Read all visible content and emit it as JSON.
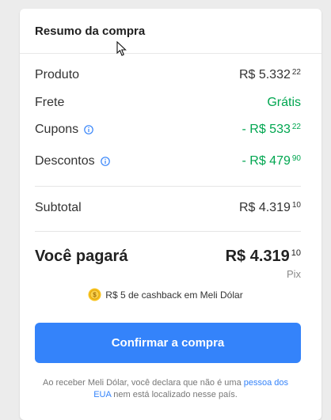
{
  "summary": {
    "title": "Resumo da compra",
    "rows": [
      {
        "label": "Produto",
        "value_main": "R$ 5.332",
        "value_cents": "22"
      },
      {
        "label": "Frete",
        "value_main": "Grátis",
        "value_cents": ""
      },
      {
        "label": "Cupons",
        "value_main": "- R$ 533",
        "value_cents": "22"
      },
      {
        "label": "Descontos",
        "value_main": "- R$ 479",
        "value_cents": "90"
      }
    ],
    "subtotal": {
      "label": "Subtotal",
      "value_main": "R$ 4.319",
      "value_cents": "10"
    },
    "total": {
      "label": "Você pagará",
      "value_main": "R$ 4.319",
      "value_cents": "10",
      "method": "Pix"
    },
    "cashback": "R$ 5 de cashback em Meli Dólar",
    "confirm_button": "Confirmar a compra",
    "disclaimer_text": "Ao receber Meli Dólar, você declara que não é uma",
    "disclaimer_link": "pessoa dos EUA",
    "disclaimer_rest": "nem está localizado nesse país."
  },
  "colors": {
    "accent": "#3483fa",
    "positive": "#00a650"
  },
  "icons": {
    "info": "info-icon",
    "coin": "coin-icon",
    "cursor": "mouse-pointer-icon"
  }
}
